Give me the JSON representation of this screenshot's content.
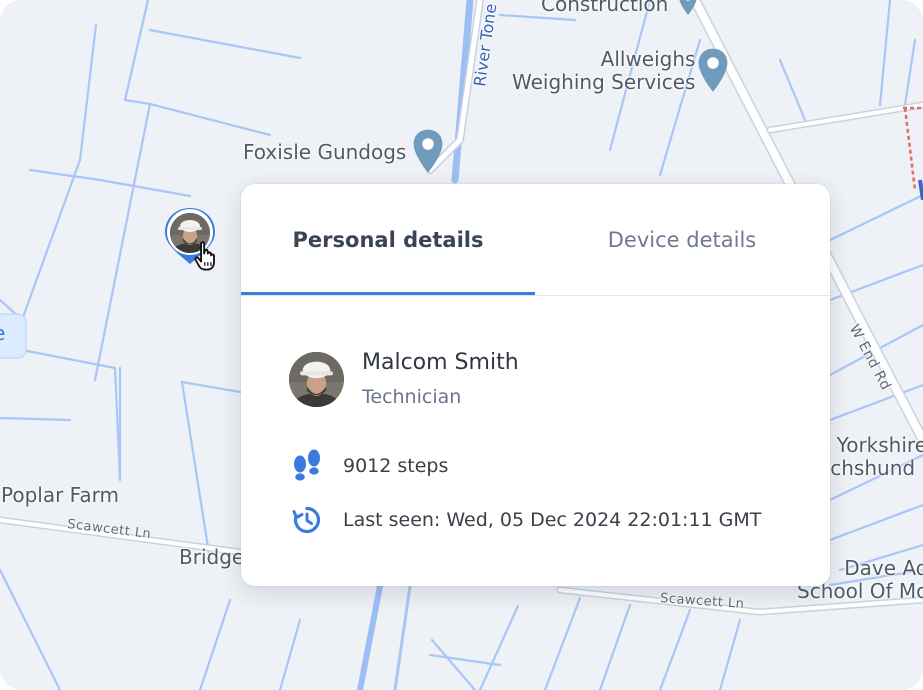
{
  "map": {
    "labels": {
      "construction": "Construction",
      "allweighs": "Allweighs\nWeighing Services",
      "foxisle": "Foxisle Gundogs",
      "river": "River Tone",
      "poplar": "Poplar Farm",
      "scawcett_1": "Scawcett Ln",
      "scawcett_2": "Scawcett Ln",
      "bridge": "Bridge",
      "wend": "W End Rd",
      "yorkshire": "e Yorkshire\nachshund",
      "dave": "Dave Ad\nSchool Of Mo",
      "edge_e": "e"
    },
    "colors": {
      "background": "#eef1f5",
      "road": "#aac8f8",
      "main_road": "#ffffff",
      "pin": "#6f9bbd"
    }
  },
  "marker": {
    "ring_color": "#3a7be0",
    "cursor_icon": "hand-pointer-icon"
  },
  "card": {
    "tabs": [
      {
        "label": "Personal details",
        "active": true
      },
      {
        "label": "Device details",
        "active": false
      }
    ],
    "user": {
      "name": "Malcom Smith",
      "role": "Technician"
    },
    "steps": "9012 steps",
    "last_seen": "Last seen: Wed, 05 Dec 2024 22:01:11 GMT",
    "accent": "#3a7be0",
    "icons": {
      "steps": "footprints-icon",
      "last_seen": "history-icon"
    }
  }
}
